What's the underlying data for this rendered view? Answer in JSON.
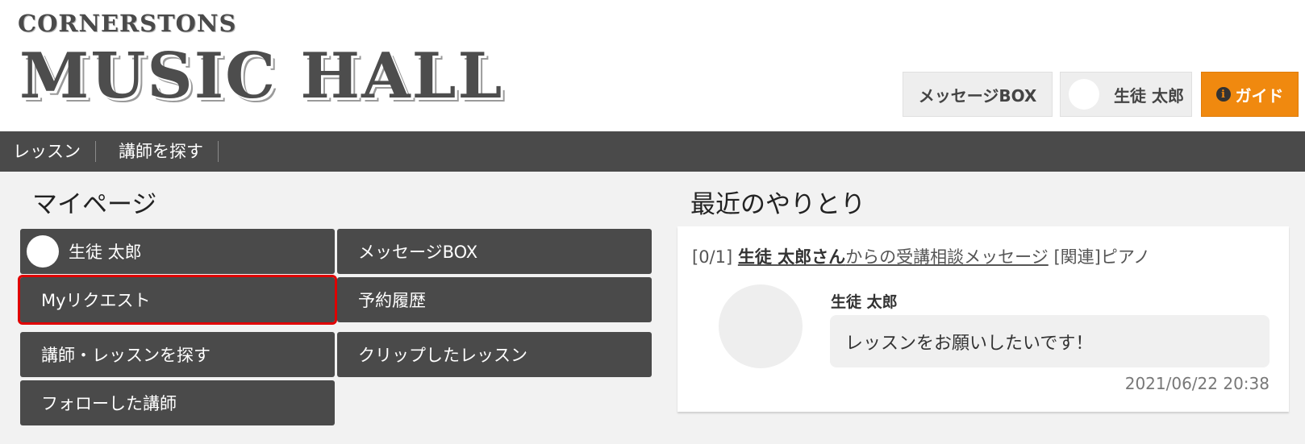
{
  "logo": {
    "line1": "CORNERSTONS",
    "line2": "MUSIC HALL"
  },
  "header": {
    "message_box_label": "メッセージBOX",
    "user_name": "生徒 太郎",
    "guide_label": "ガイド",
    "guide_icon": "info-icon",
    "guide_color": "#f0890f"
  },
  "nav": {
    "items": [
      {
        "label": "レッスン"
      },
      {
        "label": "講師を探す"
      }
    ]
  },
  "mypage": {
    "title": "マイページ",
    "tiles": [
      {
        "label": "生徒 太郎"
      },
      {
        "label": "メッセージBOX"
      },
      {
        "label": "Myリクエスト"
      },
      {
        "label": "予約履歴"
      },
      {
        "label": "講師・レッスンを探す"
      },
      {
        "label": "クリップしたレッスン"
      },
      {
        "label": "フォローした講師"
      }
    ],
    "selected_color": "#e00000"
  },
  "recent": {
    "title": "最近のやりとり",
    "thread": {
      "count": "[0/1]",
      "sender_bold": "生徒 太郎さん",
      "link_rest": "からの受講相談メッセージ",
      "related_tag": "[関連]",
      "related_value": "ピアノ"
    },
    "message": {
      "sender": "生徒 太郎",
      "text": "レッスンをお願いしたいです！",
      "timestamp": "2021/06/22 20:38"
    }
  }
}
